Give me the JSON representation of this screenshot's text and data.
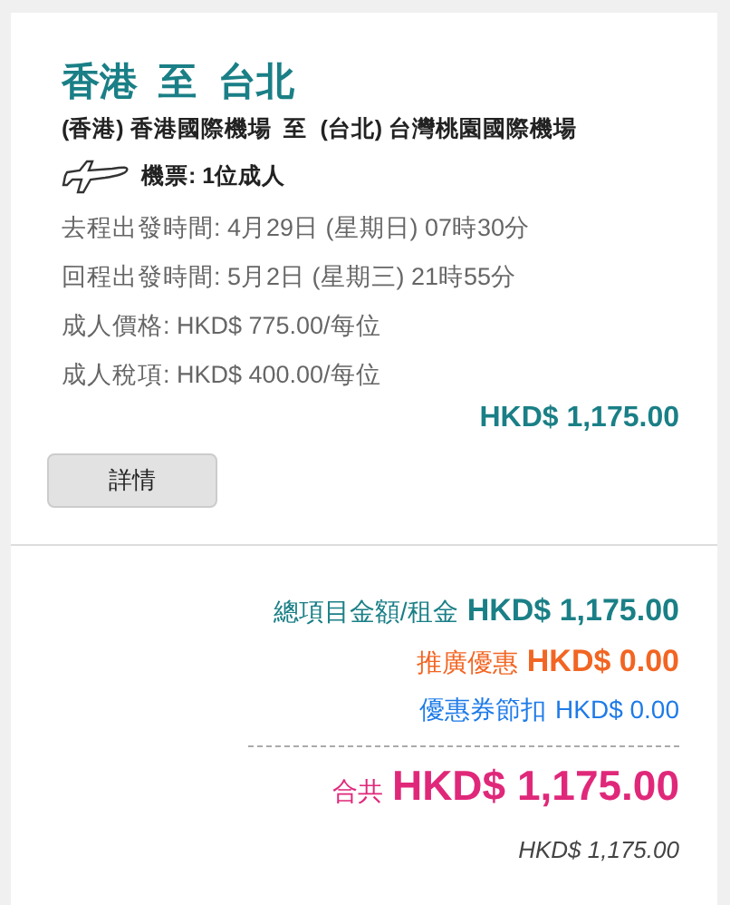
{
  "route": {
    "title": "香港  至  台北",
    "airports": "(香港) 香港國際機場  至  (台北) 台灣桃園國際機場",
    "tickets": "機票: 1位成人"
  },
  "details": [
    "去程出發時間: 4月29日 (星期日) 07時30分",
    "回程出發時間: 5月2日 (星期三) 21時55分",
    "成人價格: HKD$ 775.00/每位",
    "成人稅項: HKD$ 400.00/每位"
  ],
  "subtotal": "HKD$ 1,175.00",
  "details_button": "詳情",
  "summary": [
    {
      "kind": "fare",
      "label": "總項目金額/租金",
      "amount": "HKD$ 1,175.00"
    },
    {
      "kind": "promo",
      "label": "推廣優惠",
      "amount": "HKD$ 0.00"
    },
    {
      "kind": "coupon",
      "label": "優惠券節扣",
      "amount": "HKD$ 0.00"
    }
  ],
  "total": {
    "label": "合共",
    "amount": "HKD$ 1,175.00"
  },
  "converted_total": "HKD$ 1,175.00"
}
